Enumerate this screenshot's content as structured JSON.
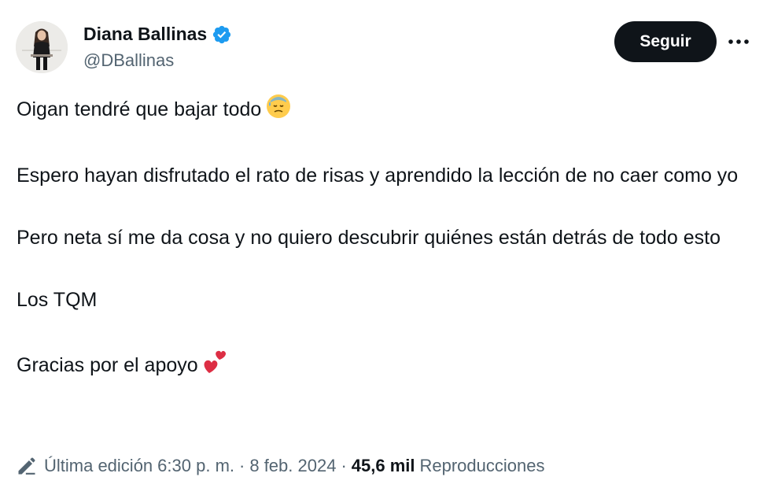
{
  "author": {
    "display_name": "Diana Ballinas",
    "handle": "@DBallinas",
    "verified": true,
    "verified_color": "#1d9bf0"
  },
  "actions": {
    "follow_label": "Seguir",
    "more_icon": "more-horizontal-icon"
  },
  "tweet": {
    "paragraphs": [
      "Oigan tendré que bajar todo",
      "Espero hayan disfrutado el rato de risas y aprendido la lección de no caer como yo",
      "Pero neta sí me da cosa y no quiero descubrir quiénes están detrás de todo esto",
      "Los TQM",
      "Gracias por el apoyo"
    ],
    "emojis": [
      "downcast-face-with-sweat-emoji",
      "two-hearts-emoji"
    ]
  },
  "meta": {
    "edited_label": "Última edición",
    "time": "6:30 p. m.",
    "separator": "·",
    "date": "8 feb. 2024",
    "views_count": "45,6 mil",
    "views_label": "Reproducciones"
  },
  "colors": {
    "text": "#0f1419",
    "secondary": "#536471",
    "button_bg": "#0f1419"
  }
}
